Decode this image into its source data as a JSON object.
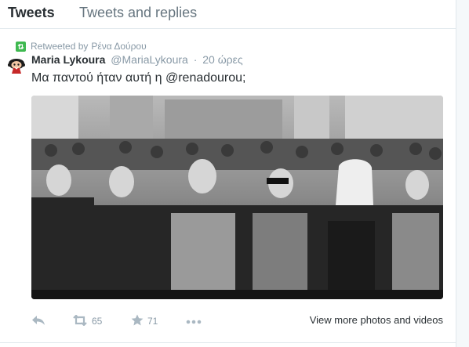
{
  "tabs": {
    "tweets": "Tweets",
    "tweets_and_replies": "Tweets and replies"
  },
  "retweet": {
    "prefix": "Retweeted by",
    "by": "Ρένα Δούρου"
  },
  "tweet": {
    "fullname": "Maria Lykoura",
    "username": "@MariaLykoura",
    "separator": "·",
    "time": "20 ώρες",
    "text": "Μα παντού ήταν αυτή η @renadourou;"
  },
  "actions": {
    "retweets": "65",
    "favorites": "71",
    "view_more": "View more photos and videos"
  },
  "icons": {
    "retweet_badge": "retweet-icon",
    "reply": "reply-icon",
    "retweet": "retweet-icon",
    "favorite": "star-icon",
    "more": "more-icon"
  },
  "colors": {
    "text": "#292f33",
    "muted": "#8899a6",
    "action_icon": "#aab8c2",
    "retweet_green": "#3fb950",
    "border": "#e1e8ed"
  }
}
